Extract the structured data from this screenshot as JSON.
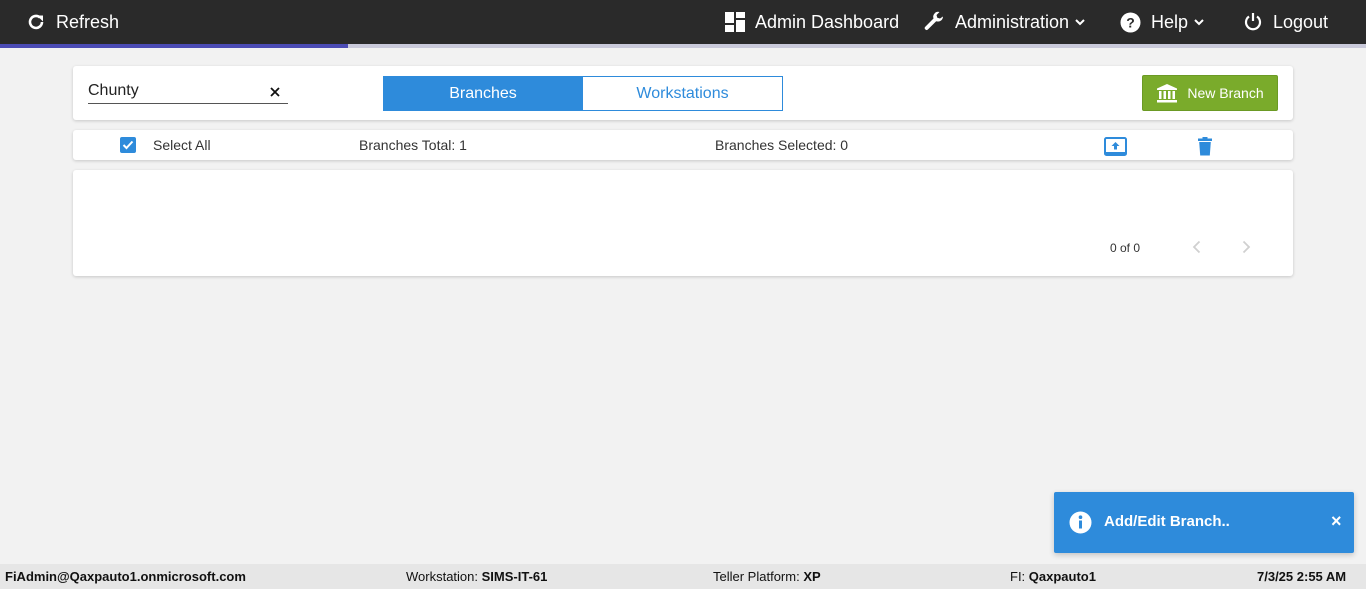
{
  "topbar": {
    "refresh_label": "Refresh",
    "admin_dashboard_label": "Admin Dashboard",
    "administration_label": "Administration",
    "help_label": "Help",
    "logout_label": "Logout",
    "progress_fraction": 0.255,
    "icons": {
      "refresh": "refresh-icon",
      "dashboard": "dashboard-icon",
      "administration": "wrench-icon",
      "help": "help-circle-icon",
      "logout": "power-icon"
    }
  },
  "search": {
    "value": "Chunty",
    "placeholder": "",
    "clear_icon": "close-icon"
  },
  "tabs": {
    "branches_label": "Branches",
    "workstations_label": "Workstations",
    "active": "Branches"
  },
  "new_branch": {
    "label": "New Branch",
    "icon": "bank-icon"
  },
  "toolbar": {
    "select_all_label": "Select All",
    "select_all_checked": true,
    "branches_total": "Branches Total: 1",
    "branches_selected": "Branches Selected: 0",
    "upload_icon": "upload-icon",
    "delete_icon": "trash-icon"
  },
  "pager": {
    "text": "0 of 0"
  },
  "toast": {
    "message": "Add/Edit Branch..",
    "close": "×",
    "icon": "info-icon"
  },
  "status": {
    "user": "FiAdmin@Qaxpauto1.onmicrosoft.com",
    "workstation_label": "Workstation: ",
    "workstation_value": "SIMS-IT-61",
    "platform_label": "Teller Platform: ",
    "platform_value": "XP",
    "fi_label": "FI: ",
    "fi_value": "Qaxpauto1",
    "datetime": "7/3/25 2:55 AM"
  },
  "colors": {
    "topbar_bg": "#2a2a2a",
    "accent_blue": "#2e8bdb",
    "button_green": "#7aab2b",
    "progress": "#4b4bb4",
    "page_bg": "#f2f2f2"
  }
}
